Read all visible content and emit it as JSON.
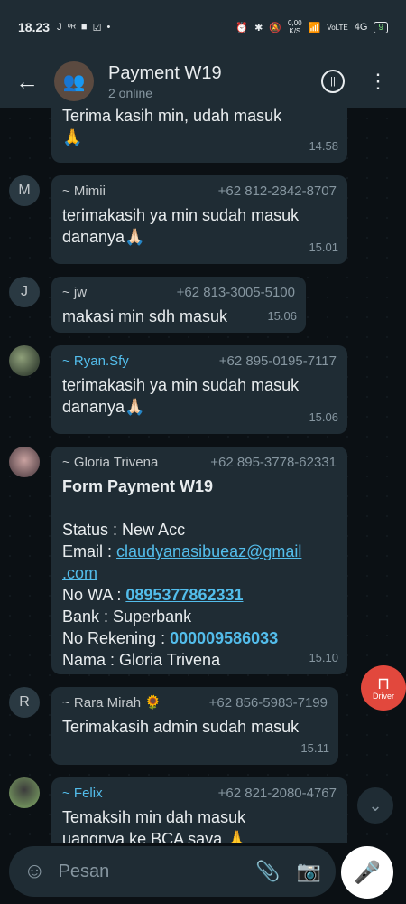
{
  "status": {
    "time": "18.23",
    "left_icons": [
      "J",
      "⁰ᴿ",
      "■",
      "☑",
      "•"
    ],
    "net_speed_top": "0,00",
    "net_speed_bottom": "K/S",
    "lte": "VoLTE",
    "signal": "4G",
    "battery": "9"
  },
  "header": {
    "title": "Payment W19",
    "subtitle": "2 online"
  },
  "messages": [
    {
      "text": "Terima kasih min, udah masuk",
      "text2": "🙏",
      "time": "14.58"
    },
    {
      "avatar": "M",
      "sender": "~ Mimii",
      "phone": "+62 812-2842-8707",
      "text": "terimakasih ya min sudah masuk",
      "text2": "dananya🙏🏻",
      "time": "15.01"
    },
    {
      "avatar": "J",
      "sender": "~ jw",
      "phone": "+62 813-3005-5100",
      "text": "makasi min sdh masuk",
      "time": "15.06"
    },
    {
      "sender": "~ Ryan.Sfy",
      "phone": "+62 895-0195-7117",
      "text": "terimakasih ya min sudah masuk",
      "text2": "dananya🙏🏻",
      "time": "15.06"
    },
    {
      "sender": "~ Gloria Trivena",
      "phone": "+62 895-3778-62331",
      "form_title": "Form Payment W19",
      "status_label": "Status : ",
      "status_value": "New Acc",
      "email_label": "Email : ",
      "email_value1": "claudyanasibueaz@gmail",
      "email_value2": ".com",
      "wa_label": "No WA : ",
      "wa_value": "0895377862331",
      "bank_label": "Bank : ",
      "bank_value": "Superbank",
      "rek_label": "No Rekening : ",
      "rek_value": "000009586033",
      "nama_label": "Nama : ",
      "nama_value": "Gloria Trivena",
      "time": "15.10"
    },
    {
      "avatar": "R",
      "sender": "~ Rara Mirah 🌻",
      "phone": "+62 856-5983-7199",
      "text": "Terimakasih admin sudah masuk",
      "time": "15.11"
    },
    {
      "sender": "~ Felix",
      "phone": "+62 821-2080-4767",
      "text": "Temaksih min dah masuk",
      "text2": "uangnya ke BCA saya 🙏"
    }
  ],
  "floating": {
    "driver_label": "Driver"
  },
  "composer": {
    "placeholder": "Pesan"
  }
}
